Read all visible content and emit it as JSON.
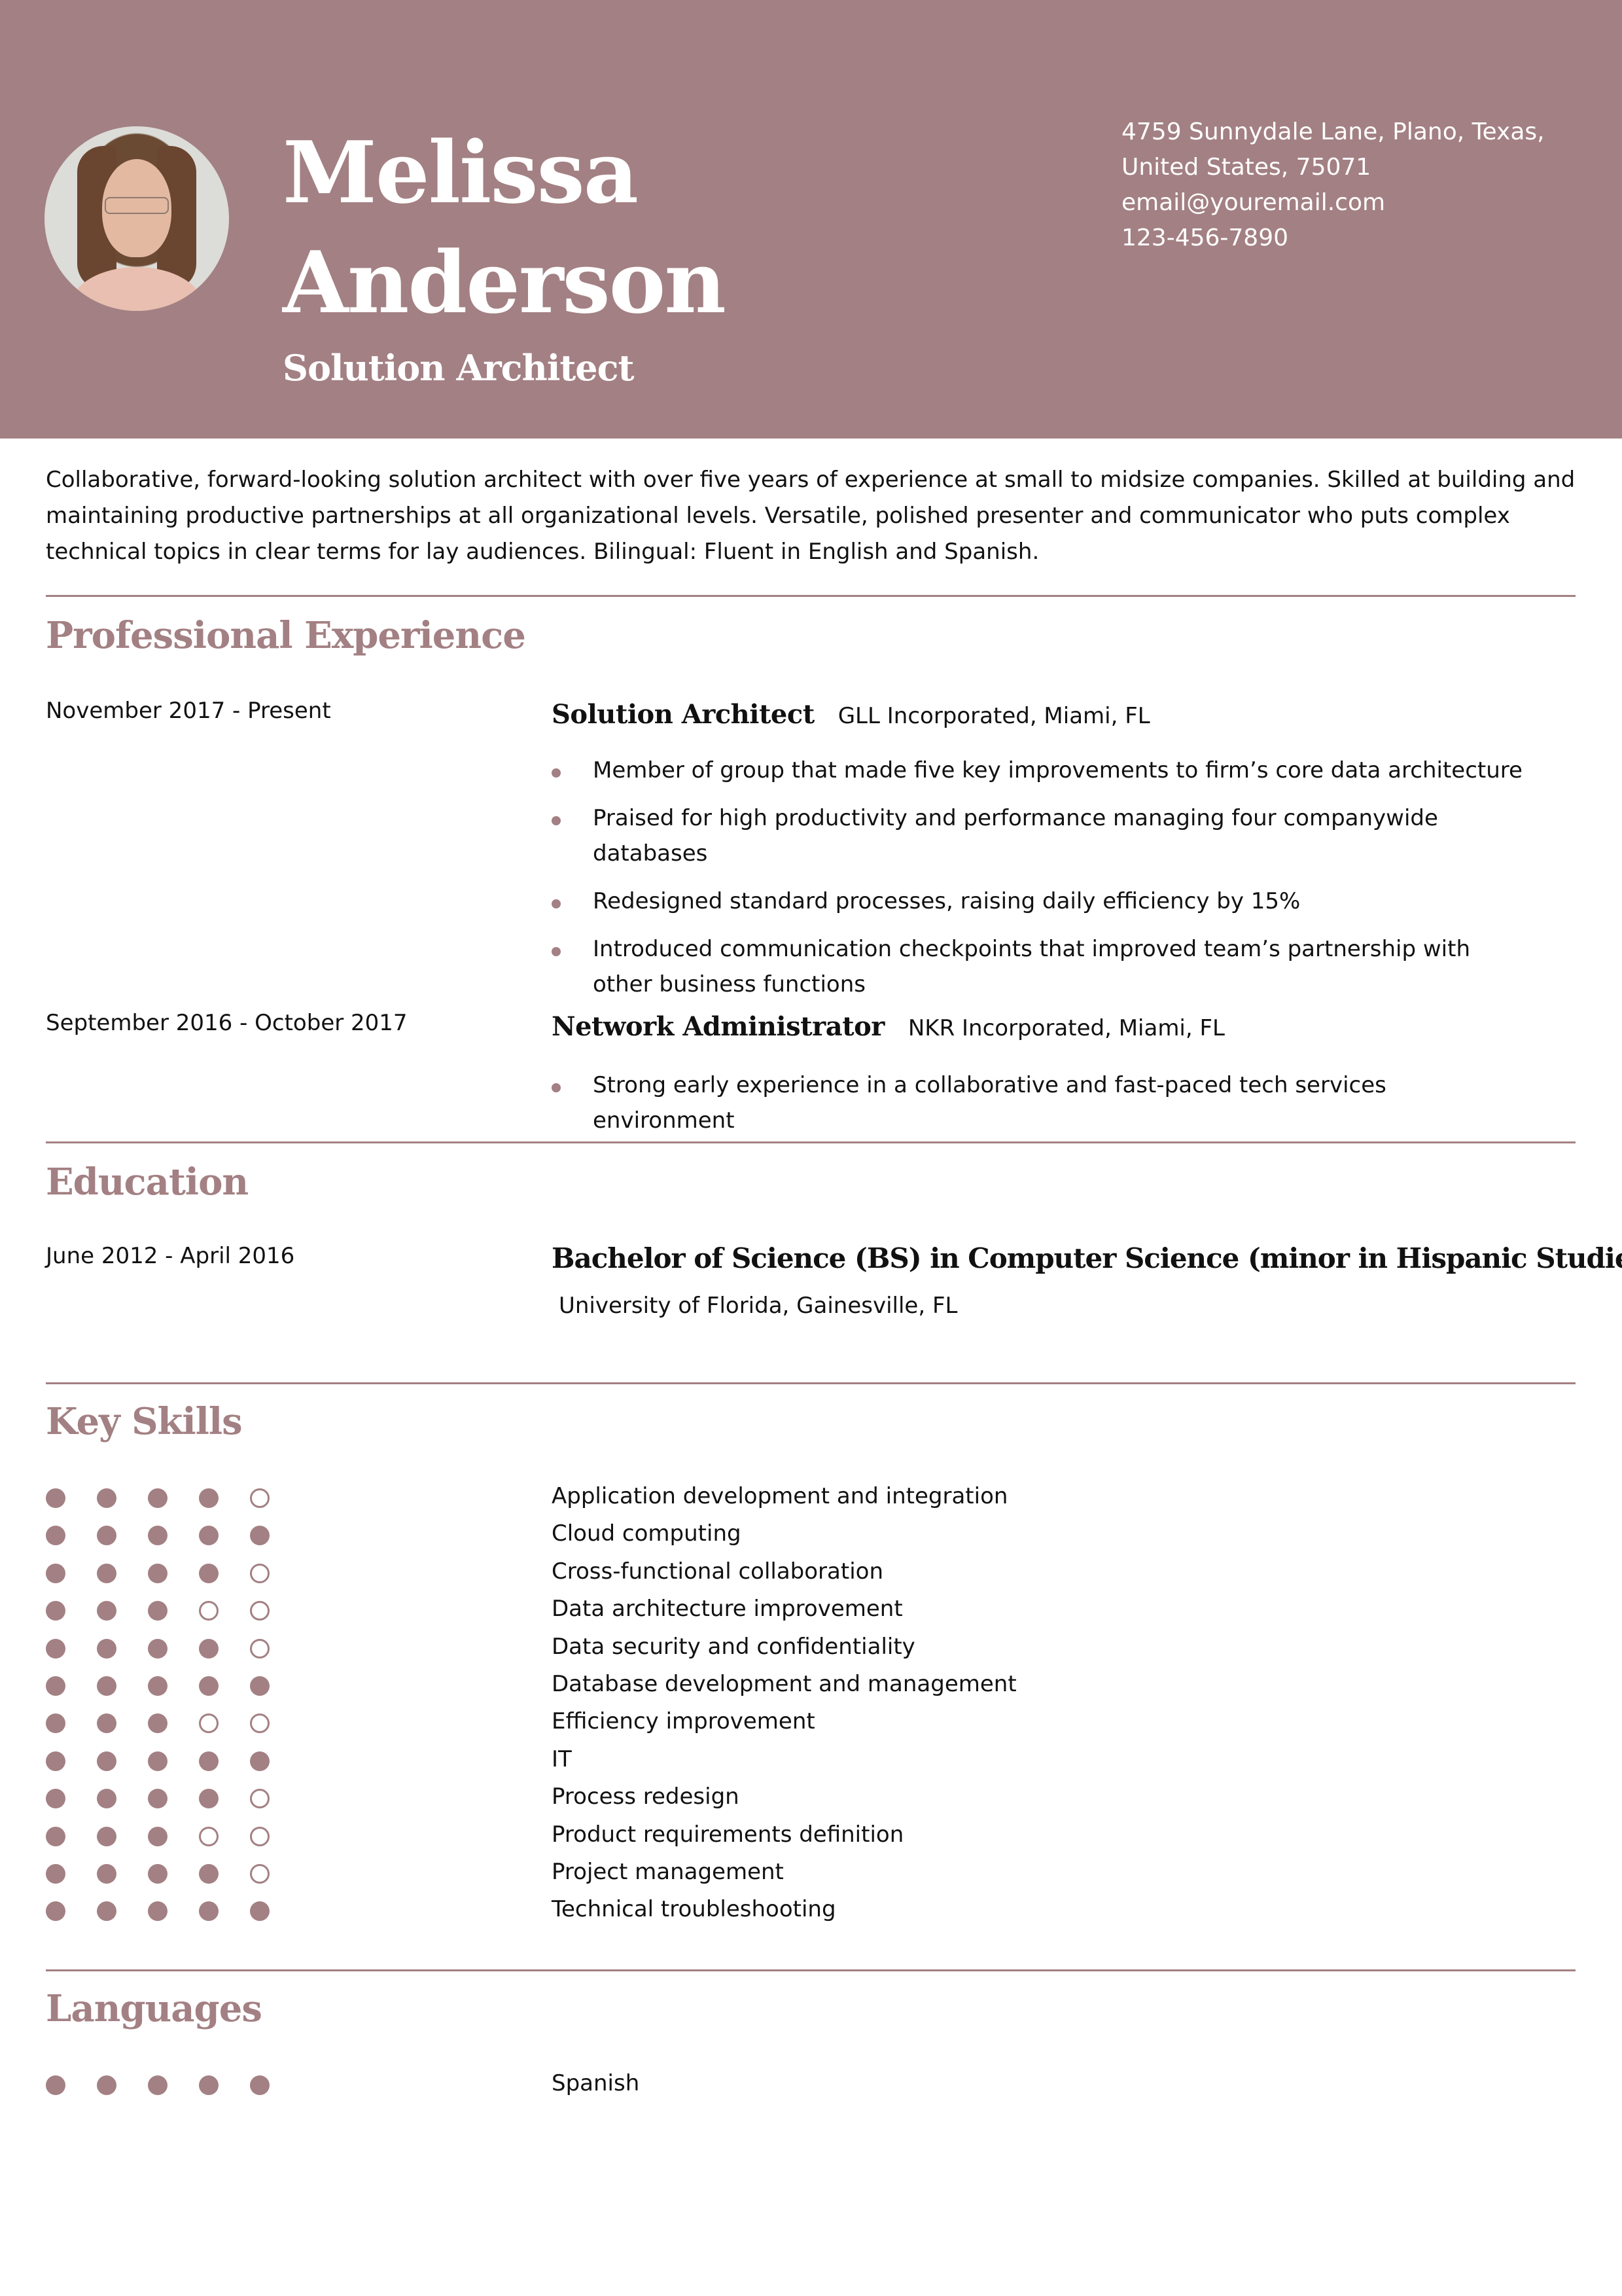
{
  "theme": {
    "accent": "#a38083"
  },
  "header": {
    "first_name": "Melissa",
    "last_name": "Anderson",
    "title": "Solution Architect",
    "photo": "portrait-photo",
    "contact": {
      "address_line1": "4759 Sunnydale Lane, Plano, Texas,",
      "address_line2": "United States, 75071",
      "email": "email@youremail.com",
      "phone": "123-456-7890"
    }
  },
  "summary": "Collaborative, forward-looking solution architect with over five years of experience at small to midsize companies. Skilled at building and maintaining productive partnerships at all organizational levels. Versatile, polished presenter and communicator who puts complex technical topics in clear terms for lay audiences. Bilingual: Fluent in English and Spanish.",
  "experience": {
    "heading": "Professional Experience",
    "jobs": [
      {
        "dates": "November 2017 - Present",
        "title": "Solution Architect",
        "company": "GLL Incorporated, Miami, FL",
        "bullets": [
          "Member of group that made five key improvements to firm’s core data architecture",
          "Praised for high productivity and performance managing four companywide databases",
          "Redesigned standard processes, raising daily efficiency by 15%",
          "Introduced communication checkpoints that improved team’s partnership with other business functions"
        ]
      },
      {
        "dates": "September 2016 - October 2017",
        "title": "Network Administrator",
        "company": "NKR Incorporated, Miami, FL",
        "bullets": [
          "Strong early experience in a collaborative and fast-paced tech services environment"
        ]
      }
    ]
  },
  "education": {
    "heading": "Education",
    "entries": [
      {
        "dates": "June 2012 - April 2016",
        "degree": "Bachelor of Science (BS) in Computer Science (minor in Hispanic Studies)",
        "school": "University of Florida, Gainesville, FL"
      }
    ]
  },
  "skills": {
    "heading": "Key Skills",
    "scale_max": 5,
    "items": [
      {
        "name": "Application development and integration",
        "rating": 4
      },
      {
        "name": "Cloud computing",
        "rating": 5
      },
      {
        "name": "Cross-functional collaboration",
        "rating": 4
      },
      {
        "name": "Data architecture improvement",
        "rating": 3
      },
      {
        "name": "Data security and confidentiality",
        "rating": 4
      },
      {
        "name": "Database development and management",
        "rating": 5
      },
      {
        "name": "Efficiency improvement",
        "rating": 3
      },
      {
        "name": "IT",
        "rating": 5
      },
      {
        "name": "Process redesign",
        "rating": 4
      },
      {
        "name": "Product requirements definition",
        "rating": 3
      },
      {
        "name": "Project management",
        "rating": 4
      },
      {
        "name": "Technical troubleshooting",
        "rating": 5
      }
    ]
  },
  "languages": {
    "heading": "Languages",
    "scale_max": 5,
    "items": [
      {
        "name": "Spanish",
        "rating": 5
      }
    ]
  }
}
